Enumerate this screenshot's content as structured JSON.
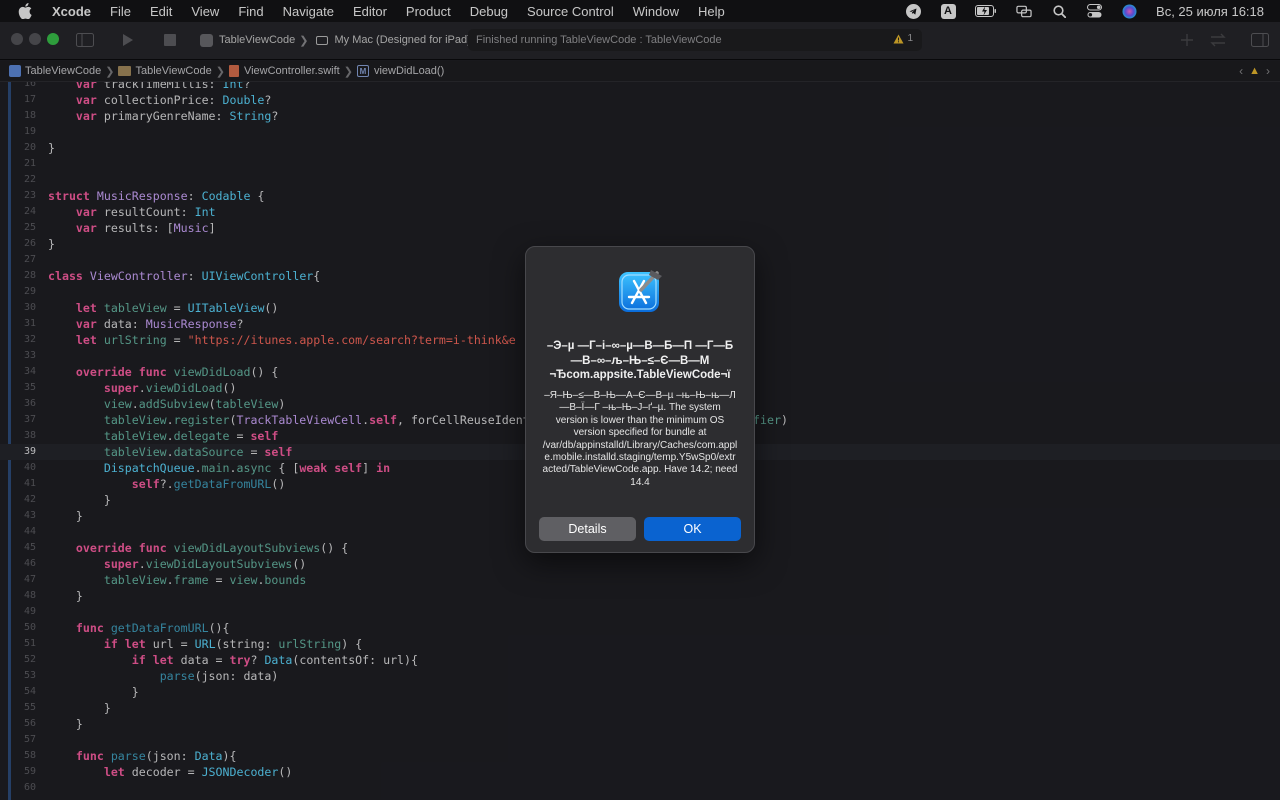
{
  "menubar": {
    "apple_icon": "apple-logo-icon",
    "items": [
      "Xcode",
      "File",
      "Edit",
      "View",
      "Find",
      "Navigate",
      "Editor",
      "Product",
      "Debug",
      "Source Control",
      "Window",
      "Help"
    ],
    "status": {
      "telegram_icon": "telegram-icon",
      "input_source": "A",
      "battery_icon": "battery-charging-icon",
      "airplay_icon": "screen-mirroring-icon",
      "search_icon": "spotlight-search-icon",
      "control_center_icon": "control-center-icon",
      "siri_icon": "siri-icon",
      "clock": "Вс, 25 июля  16:18"
    }
  },
  "toolbar": {
    "scheme": "TableViewCode",
    "destination": "My Mac (Designed for iPad)",
    "activity": "Finished running TableViewCode : TableViewCode",
    "warning_count": "1"
  },
  "jumpbar": {
    "crumbs": [
      "TableViewCode",
      "TableViewCode",
      "ViewController.swift",
      "viewDidLoad()"
    ],
    "method_badge": "M"
  },
  "editor": {
    "current_line": "39",
    "lines": [
      {
        "n": "16",
        "t": "    var trackTimeMillis: Int?"
      },
      {
        "n": "17",
        "t": "    var collectionPrice: Double?"
      },
      {
        "n": "18",
        "t": "    var primaryGenreName: String?"
      },
      {
        "n": "19",
        "t": ""
      },
      {
        "n": "20",
        "t": "}"
      },
      {
        "n": "21",
        "t": ""
      },
      {
        "n": "22",
        "t": ""
      },
      {
        "n": "23",
        "t": "struct MusicResponse: Codable {"
      },
      {
        "n": "24",
        "t": "    var resultCount: Int"
      },
      {
        "n": "25",
        "t": "    var results: [Music]"
      },
      {
        "n": "26",
        "t": "}"
      },
      {
        "n": "27",
        "t": ""
      },
      {
        "n": "28",
        "t": "class ViewController: UIViewController{"
      },
      {
        "n": "29",
        "t": ""
      },
      {
        "n": "30",
        "t": "    let tableView = UITableView()"
      },
      {
        "n": "31",
        "t": "    var data: MusicResponse?"
      },
      {
        "n": "32",
        "t": "    let urlString = \"https://itunes.apple.com/search?term=i-think&e"
      },
      {
        "n": "33",
        "t": ""
      },
      {
        "n": "34",
        "t": "    override func viewDidLoad() {"
      },
      {
        "n": "35",
        "t": "        super.viewDidLoad()"
      },
      {
        "n": "36",
        "t": "        view.addSubview(tableView)"
      },
      {
        "n": "37",
        "t": "        tableView.register(TrackTableViewCell.self, forCellReuseIdentifier: TrackTableViewCell.identifier)"
      },
      {
        "n": "38",
        "t": "        tableView.delegate = self"
      },
      {
        "n": "39",
        "t": "        tableView.dataSource = self"
      },
      {
        "n": "40",
        "t": "        DispatchQueue.main.async { [weak self] in"
      },
      {
        "n": "41",
        "t": "            self?.getDataFromURL()"
      },
      {
        "n": "42",
        "t": "        }"
      },
      {
        "n": "43",
        "t": "    }"
      },
      {
        "n": "44",
        "t": ""
      },
      {
        "n": "45",
        "t": "    override func viewDidLayoutSubviews() {"
      },
      {
        "n": "46",
        "t": "        super.viewDidLayoutSubviews()"
      },
      {
        "n": "47",
        "t": "        tableView.frame = view.bounds"
      },
      {
        "n": "48",
        "t": "    }"
      },
      {
        "n": "49",
        "t": ""
      },
      {
        "n": "50",
        "t": "    func getDataFromURL(){"
      },
      {
        "n": "51",
        "t": "        if let url = URL(string: urlString) {"
      },
      {
        "n": "52",
        "t": "            if let data = try? Data(contentsOf: url){"
      },
      {
        "n": "53",
        "t": "                parse(json: data)"
      },
      {
        "n": "54",
        "t": "            }"
      },
      {
        "n": "55",
        "t": "        }"
      },
      {
        "n": "56",
        "t": "    }"
      },
      {
        "n": "57",
        "t": ""
      },
      {
        "n": "58",
        "t": "    func parse(json: Data){"
      },
      {
        "n": "59",
        "t": "        let decoder = JSONDecoder()"
      },
      {
        "n": "60",
        "t": ""
      }
    ]
  },
  "dialog": {
    "icon": "xcode-app-icon",
    "title": "–Э–µ —Г–і–∞–µ—В—Б—П —Г—Б—В–∞–љ–Њ–≤–Є—В—М ¬Ђcom.appsite.TableViewCode¬ї",
    "message": "–Я–Њ–≤—В–Њ—А–Є—В–µ –њ–Њ–њ—Л—В–Ї—Г –њ–Њ–Ј–ґ–µ. The system version is lower than the minimum OS version specified for bundle at /var/db/appinstalld/Library/Caches/com.apple.mobile.installd.staging/temp.Y5wSp0/extracted/TableViewCode.app. Have 14.2; need 14.4",
    "buttons": {
      "details": "Details",
      "ok": "OK"
    },
    "ok_color": "#0a63d0"
  },
  "colors": {
    "editor_bg": "#1f1f24",
    "keyword": "#fc5fa3",
    "type": "#5dd8ff",
    "string": "#fc6a5d"
  }
}
